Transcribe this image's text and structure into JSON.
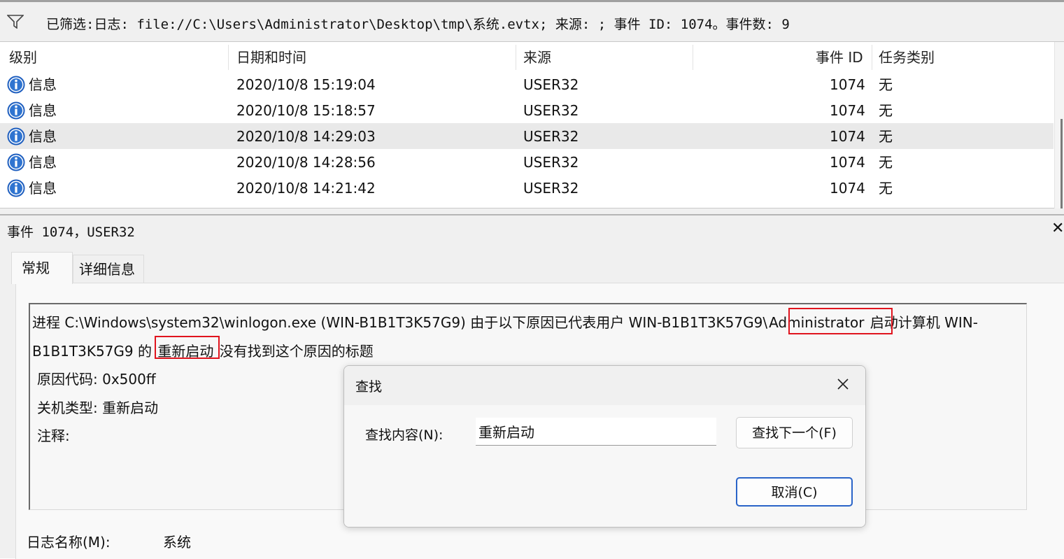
{
  "filter_bar": {
    "text": "已筛选:日志: file://C:\\Users\\Administrator\\Desktop\\tmp\\系统.evtx; 来源: ; 事件 ID: 1074。事件数: 9"
  },
  "grid": {
    "columns": [
      "级别",
      "日期和时间",
      "来源",
      "事件 ID",
      "任务类别"
    ],
    "rows": [
      {
        "level": "信息",
        "datetime": "2020/10/8 15:19:04",
        "source": "USER32",
        "event_id": "1074",
        "task": "无"
      },
      {
        "level": "信息",
        "datetime": "2020/10/8 15:18:57",
        "source": "USER32",
        "event_id": "1074",
        "task": "无"
      },
      {
        "level": "信息",
        "datetime": "2020/10/8 14:29:03",
        "source": "USER32",
        "event_id": "1074",
        "task": "无"
      },
      {
        "level": "信息",
        "datetime": "2020/10/8 14:28:56",
        "source": "USER32",
        "event_id": "1074",
        "task": "无"
      },
      {
        "level": "信息",
        "datetime": "2020/10/8 14:21:42",
        "source": "USER32",
        "event_id": "1074",
        "task": "无"
      }
    ]
  },
  "details": {
    "title": "事件 1074，USER32",
    "tabs": [
      "常规",
      "详细信息"
    ],
    "message": {
      "line1_a": "进程 C:\\Windows\\system32\\winlogon.exe (WIN-B1B1T3K57G9) 由于以下原因已代表用户 WIN-B1B1T3K57G9\\",
      "line1_hl": "Administrator",
      "line1_b": " 启动计算机 WIN-",
      "line2_a": "B1B1T3K57G9 的 ",
      "line2_hl": "重新启动",
      "line2_b": " 没有找到这个原因的标题",
      "reason_code": "原因代码: 0x500ff",
      "shutdown_type": "关机类型: 重新启动",
      "comment": "注释:"
    },
    "log_name_label": "日志名称(M):",
    "log_name_value": "系统"
  },
  "find_dialog": {
    "title": "查找",
    "label": "查找内容(N):",
    "value": "重新启动",
    "find_next": "查找下一个(F)",
    "cancel": "取消(C)"
  },
  "colors": {
    "highlight": "#e0141e",
    "info_icon": "#1f5fbf",
    "selected_row": "#e9e9e9",
    "default_button_border": "#2a64c8"
  }
}
